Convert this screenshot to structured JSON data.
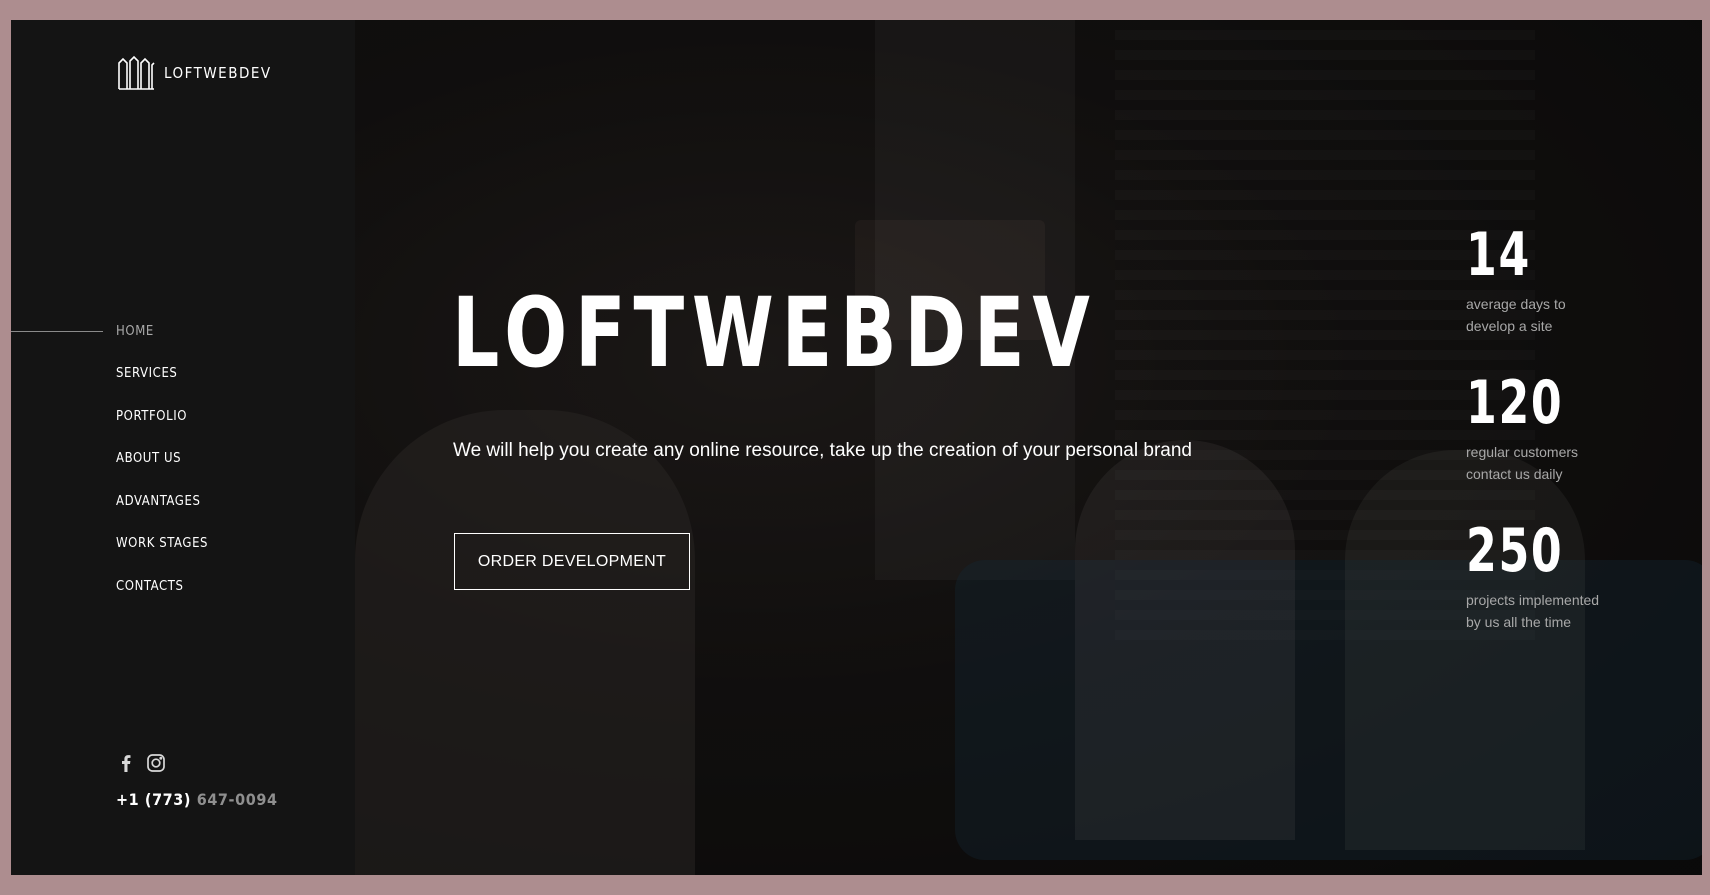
{
  "brand": {
    "name": "LOFTWEBDEV"
  },
  "nav": {
    "items": [
      {
        "label": "HOME",
        "active": true
      },
      {
        "label": "SERVICES"
      },
      {
        "label": "PORTFOLIO"
      },
      {
        "label": "ABOUT US"
      },
      {
        "label": "ADVANTAGES"
      },
      {
        "label": "WORK STAGES"
      },
      {
        "label": "CONTACTS"
      }
    ]
  },
  "social": {
    "icons": [
      "facebook-icon",
      "instagram-icon"
    ]
  },
  "contact": {
    "phone_prefix": "+1 (773)",
    "phone_number": "647-0094"
  },
  "hero": {
    "title": "LOFTWEBDEV",
    "subtitle": "We will help you create any online resource, take up the creation of your personal brand",
    "cta_label": "ORDER DEVELOPMENT"
  },
  "stats": [
    {
      "value": "14",
      "desc": "average days to\ndevelop a site"
    },
    {
      "value": "120",
      "desc": "regular customers\ncontact us daily"
    },
    {
      "value": "250",
      "desc": "projects implemented\nby us all the time"
    }
  ],
  "colors": {
    "background": "#1b1b1b",
    "sidebar": "#141414",
    "outer_frame": "#ad8d8f",
    "muted_text": "#a8a8a8"
  }
}
